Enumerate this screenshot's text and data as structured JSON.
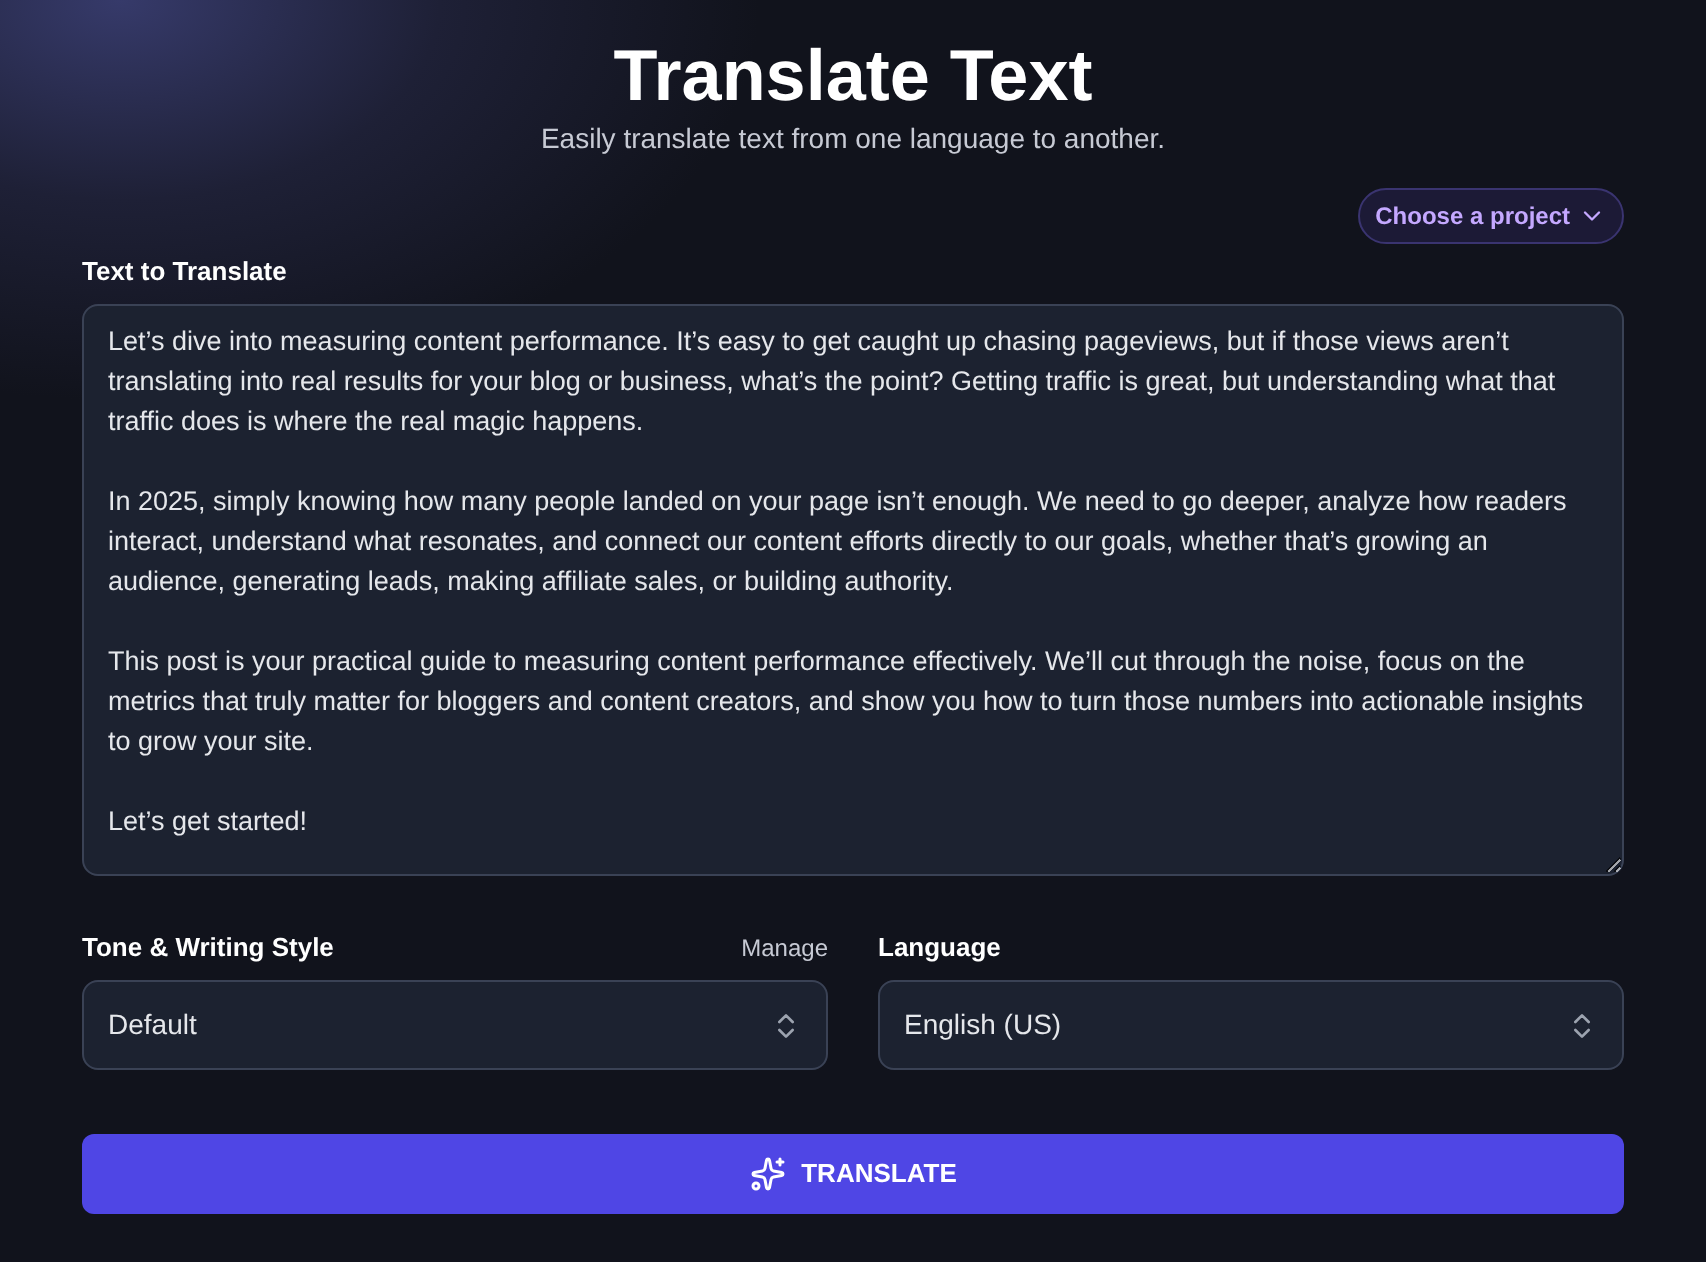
{
  "header": {
    "title": "Translate Text",
    "subtitle": "Easily translate text from one language to another."
  },
  "project_picker": {
    "label": "Choose a project"
  },
  "text_input": {
    "label": "Text to Translate",
    "value": "Let’s dive into measuring content performance. It’s easy to get caught up chasing pageviews, but if those views aren’t translating into real results for your blog or business, what’s the point? Getting traffic is great, but understanding what that traffic does is where the real magic happens.\n\nIn 2025, simply knowing how many people landed on your page isn’t enough. We need to go deeper, analyze how readers interact, understand what resonates, and connect our content efforts directly to our goals, whether that’s growing an audience, generating leads, making affiliate sales, or building authority.\n\nThis post is your practical guide to measuring content performance effectively. We’ll cut through the noise, focus on the metrics that truly matter for bloggers and content creators, and show you how to turn those numbers into actionable insights to grow your site.\n\nLet’s get started!"
  },
  "tone": {
    "label": "Tone & Writing Style",
    "link": "Manage",
    "value": "Default"
  },
  "language": {
    "label": "Language",
    "value": "English (US)"
  },
  "translate_button": {
    "label": "TRANSLATE"
  }
}
